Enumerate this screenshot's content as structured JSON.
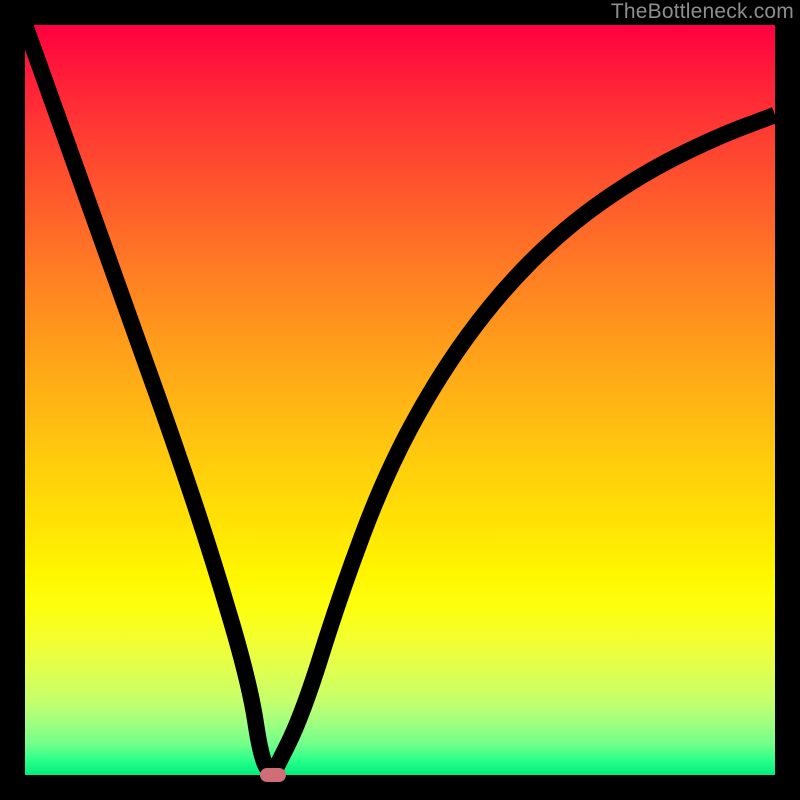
{
  "watermark": "TheBottleneck.com",
  "chart_data": {
    "type": "line",
    "title": "",
    "xlabel": "",
    "ylabel": "",
    "xlim": [
      0,
      100
    ],
    "ylim": [
      0,
      100
    ],
    "grid": false,
    "legend": false,
    "series": [
      {
        "name": "curve",
        "x": [
          0,
          5,
          10,
          15,
          20,
          25,
          30,
          31.5,
          33,
          37,
          42,
          48,
          55,
          63,
          72,
          82,
          92,
          100
        ],
        "values": [
          100,
          86,
          72,
          58,
          44,
          29,
          12,
          2,
          0,
          8,
          24,
          40,
          53,
          64,
          73,
          80,
          85,
          88
        ]
      }
    ],
    "vertex": {
      "x": 33,
      "y": 0
    }
  },
  "gradient_colors": {
    "top": "#ff0040",
    "mid_upper": "#ff7a24",
    "mid": "#ffe404",
    "mid_lower": "#e0ff50",
    "bottom": "#00eb7e"
  },
  "marker_color": "#cf6e77"
}
